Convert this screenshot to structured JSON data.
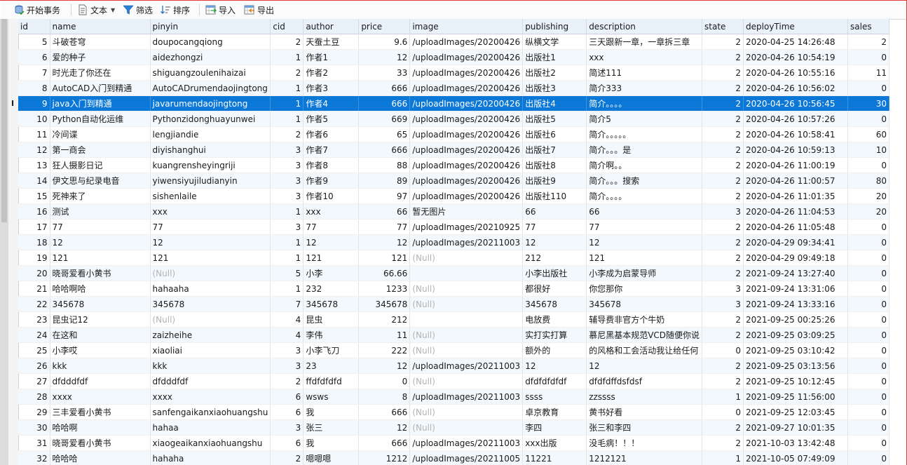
{
  "toolbar": {
    "begin_transaction": "开始事务",
    "text": "文本",
    "filter": "筛选",
    "sort": "排序",
    "import": "导入",
    "export": "导出"
  },
  "columns": [
    {
      "key": "id",
      "label": "id"
    },
    {
      "key": "name",
      "label": "name"
    },
    {
      "key": "pinyin",
      "label": "pinyin"
    },
    {
      "key": "cid",
      "label": "cid"
    },
    {
      "key": "author",
      "label": "author"
    },
    {
      "key": "price",
      "label": "price"
    },
    {
      "key": "image",
      "label": "image"
    },
    {
      "key": "publishing",
      "label": "publishing"
    },
    {
      "key": "description",
      "label": "description"
    },
    {
      "key": "state",
      "label": "state"
    },
    {
      "key": "deployTime",
      "label": "deployTime"
    },
    {
      "key": "sales",
      "label": "sales"
    }
  ],
  "null_text": "(Null)",
  "row_indicator": "I",
  "selected_row_index": 4,
  "rows": [
    [
      "5",
      "斗破苍穹",
      "doupocangqiong",
      "2",
      "天蚕土豆",
      "9.6",
      "/uploadImages/20200426",
      "纵横文学",
      "三天跟新一章，一章拆三章",
      "2",
      "2020-04-25 14:26:48",
      "2"
    ],
    [
      "6",
      "爱的种子",
      "aidezhongzi",
      "1",
      "作者1",
      "12",
      "/uploadImages/20200426",
      "出版社1",
      "xxx",
      "2",
      "2020-04-26 10:54:19",
      "0"
    ],
    [
      "7",
      "时光走了你还在",
      "shiguangzoulenihaizai",
      "2",
      "作者2",
      "33",
      "/uploadImages/20200426",
      "出版社2",
      "简述111",
      "2",
      "2020-04-26 10:55:16",
      "11"
    ],
    [
      "8",
      "AutoCAD入门到精通",
      "AutoCADrumendaojingtong",
      "1",
      "作者3",
      "666",
      "/uploadImages/20200426",
      "出版社3",
      "简介333",
      "2",
      "2020-04-26 10:56:02",
      "0"
    ],
    [
      "9",
      "java入门到精通",
      "javarumendaojingtong",
      "1",
      "作者4",
      "666",
      "/uploadImages/20200426",
      "出版社4",
      "简介。。。。",
      "2",
      "2020-04-26 10:56:45",
      "30"
    ],
    [
      "10",
      "Python自动化运维",
      "Pythonzidonghuayunwei",
      "1",
      "作者5",
      "669",
      "/uploadImages/20200426",
      "出版社5",
      "简介5",
      "2",
      "2020-04-26 10:57:26",
      "0"
    ],
    [
      "11",
      "冷间谍",
      "lengjiandie",
      "2",
      "作者6",
      "65",
      "/uploadImages/20200426",
      "出版社6",
      "简介。。。。。",
      "2",
      "2020-04-26 10:58:41",
      "60"
    ],
    [
      "12",
      "第一商会",
      "diyishanghui",
      "3",
      "作者7",
      "666",
      "/uploadImages/20200426",
      "出版社7",
      "简介。。。是",
      "2",
      "2020-04-26 10:59:13",
      "10"
    ],
    [
      "13",
      "狂人摄影日记",
      "kuangrensheyingriji",
      "3",
      "作者8",
      "88",
      "/uploadImages/20200426",
      "出版社8",
      "简介啊。。",
      "2",
      "2020-04-26 11:00:19",
      "0"
    ],
    [
      "14",
      "伊文思与纪录电音",
      "yiwensiyujiludianyin",
      "3",
      "作者9",
      "89",
      "/uploadImages/20200426",
      "出版社9",
      "简介。。。搜索",
      "2",
      "2020-04-26 11:00:57",
      "80"
    ],
    [
      "15",
      "死神来了",
      "sishenlaile",
      "3",
      "作者10",
      "97",
      "/uploadImages/20200426",
      "出版社110",
      "简介。。。。",
      "2",
      "2020-04-26 11:01:35",
      "20"
    ],
    [
      "16",
      "测试",
      "xxx",
      "1",
      "xxx",
      "66",
      "暂无图片",
      "66",
      "66",
      "3",
      "2020-04-26 11:04:53",
      "20"
    ],
    [
      "17",
      "77",
      "77",
      "3",
      "77",
      "77",
      "/uploadImages/20210925",
      "77",
      "77",
      "2",
      "2020-04-26 11:05:48",
      "0"
    ],
    [
      "18",
      "12",
      "12",
      "1",
      "12",
      "12",
      "/uploadImages/20211003",
      "12",
      "12",
      "2",
      "2020-04-29 09:34:41",
      "0"
    ],
    [
      "19",
      "121",
      "121",
      "1",
      "121",
      "121",
      null,
      "212",
      "121",
      "2",
      "2020-04-29 09:49:18",
      "0"
    ],
    [
      "20",
      "晓哥爱看小黄书",
      null,
      "5",
      "小李",
      "66.66",
      "",
      "小李出版社",
      "小李成为启蒙导师",
      "2",
      "2021-09-24 13:27:40",
      "0"
    ],
    [
      "21",
      "哈哈啊哈",
      "hahaaha",
      "1",
      "232",
      "1233",
      null,
      "都很好",
      "你您那你",
      "3",
      "2021-09-24 13:31:06",
      "0"
    ],
    [
      "22",
      "345678",
      "345678",
      "7",
      "345678",
      "345678",
      null,
      "345678",
      "345678",
      "3",
      "2021-09-24 13:33:16",
      "0"
    ],
    [
      "23",
      "昆虫记12",
      null,
      "4",
      "昆虫",
      "212",
      "",
      "电放费",
      "辅导费非官方个牛奶",
      "2",
      "2021-09-25 00:25:26",
      "0"
    ],
    [
      "24",
      "在这和",
      "zaizheihe",
      "4",
      "李伟",
      "11",
      null,
      "实打实打算",
      "慕尼黑基本规范VCD随便你说",
      "2",
      "2021-09-25 03:09:25",
      "0"
    ],
    [
      "25",
      "小李哎",
      "xiaoliai",
      "3",
      "小李飞刀",
      "222",
      null,
      "额外的",
      "的风格和工会活动我让给任何",
      "0",
      "2021-09-25 03:10:42",
      "0"
    ],
    [
      "26",
      "kkk",
      "kkk",
      "3",
      "23",
      "12",
      "/uploadImages/20211003",
      "12",
      "12",
      "2",
      "2021-09-25 03:13:56",
      "0"
    ],
    [
      "27",
      "dfdddfdf",
      "dfdddfdf",
      "2",
      "ffdfdfdfd",
      "0",
      null,
      "dfdfdfdfdf",
      "dfdfdffdsfdsf",
      "2",
      "2021-09-25 10:12:45",
      "0"
    ],
    [
      "28",
      "xxxx",
      "xxxx",
      "6",
      "wsws",
      "8",
      "/uploadImages/20211003",
      "ssss",
      "zzssss",
      "1",
      "2021-09-25 11:56:00",
      "0"
    ],
    [
      "29",
      "三丰爱看小黄书",
      "sanfengaikanxiaohuangshu",
      "6",
      "我",
      "666",
      null,
      "卓京教育",
      "黄书好看",
      "0",
      "2021-09-25 12:03:45",
      "0"
    ],
    [
      "30",
      "哈哈啊",
      "hahaa",
      "3",
      "张三",
      "12",
      null,
      "李四",
      "张三和李四",
      "2",
      "2021-09-27 10:01:35",
      "0"
    ],
    [
      "31",
      "晓哥爱看小黄书",
      "xiaogeaikanxiaohuangshu",
      "6",
      "我",
      "666",
      "/uploadImages/20211003",
      "xxx出版",
      "没毛病！！！",
      "2",
      "2021-10-03 13:42:48",
      "0"
    ],
    [
      "32",
      "哈哈哈",
      "hahaha",
      "2",
      "嗯嗯嗯",
      "1212",
      "/uploadImages/20211005",
      "11221",
      "1212121",
      "1",
      "2021-10-05 07:49:09",
      "0"
    ]
  ]
}
